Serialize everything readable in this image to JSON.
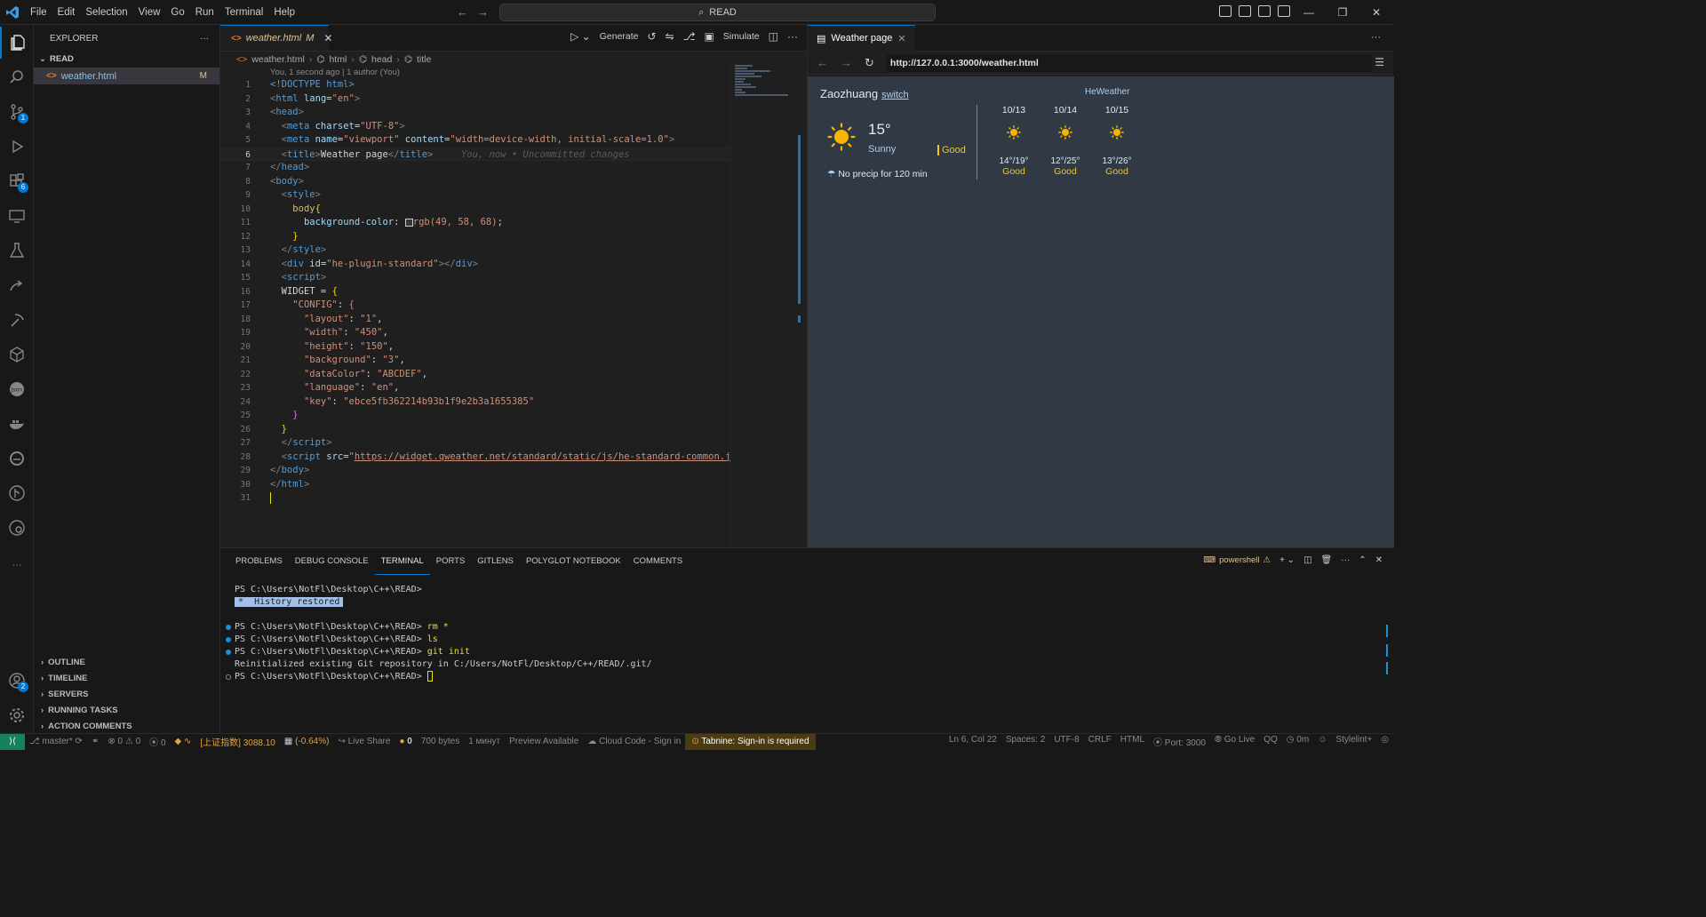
{
  "titlebar": {
    "menu": [
      "File",
      "Edit",
      "Selection",
      "View",
      "Go",
      "Run",
      "Terminal",
      "Help"
    ],
    "search": "READ"
  },
  "activity": {
    "badges": {
      "scm": "1",
      "extensions": "6",
      "accounts": "2"
    }
  },
  "sidebar": {
    "title": "EXPLORER",
    "folder": "READ",
    "file": {
      "name": "weather.html",
      "status": "M"
    },
    "sections": [
      "OUTLINE",
      "TIMELINE",
      "SERVERS",
      "RUNNING TASKS",
      "ACTION COMMENTS"
    ]
  },
  "editor": {
    "tab": {
      "name": "weather.html",
      "status": "M"
    },
    "toolbar": {
      "generate": "Generate",
      "simulate": "Simulate"
    },
    "breadcrumb": [
      "weather.html",
      "html",
      "head",
      "title"
    ],
    "blame": "You, 1 second ago | 1 author (You)",
    "current_line_hint": "You, now • Uncommitted changes",
    "line_numbers": [
      "1",
      "2",
      "3",
      "4",
      "5",
      "6",
      "7",
      "8",
      "9",
      "10",
      "11",
      "12",
      "13",
      "14",
      "15",
      "16",
      "17",
      "18",
      "19",
      "20",
      "21",
      "22",
      "23",
      "24",
      "25",
      "26",
      "27",
      "28",
      "29",
      "30",
      "31"
    ],
    "code": {
      "doctype": "<!DOCTYPE html>",
      "html_lang": "en",
      "charset": "UTF-8",
      "viewport_name": "viewport",
      "viewport_content": "width=device-width, initial-scale=1.0",
      "title": "Weather page",
      "bg_color": "rgb(49, 58, 68)",
      "div_id": "he-plugin-standard",
      "config": {
        "layout": "1",
        "width": "450",
        "height": "150",
        "background": "3",
        "dataColor": "ABCDEF",
        "language": "en",
        "key": "ebce5fb362214b93b1f9e2b3a1655385"
      },
      "script_src": "https://widget.qweather.net/standard/static/js/he-standard-common.js"
    }
  },
  "preview": {
    "tab_title": "Weather page",
    "url": "http://127.0.0.1:3000/weather.html",
    "widget": {
      "city": "Zaozhuang",
      "switch": "switch",
      "brand": "HeWeather",
      "temp": "15°",
      "condition": "Sunny",
      "aqi": "Good",
      "precip": "No precip for 120 min",
      "forecast": [
        {
          "date": "10/13",
          "range": "14°/19°",
          "quality": "Good"
        },
        {
          "date": "10/14",
          "range": "12°/25°",
          "quality": "Good"
        },
        {
          "date": "10/15",
          "range": "13°/26°",
          "quality": "Good"
        }
      ]
    }
  },
  "panel": {
    "tabs": [
      "PROBLEMS",
      "DEBUG CONSOLE",
      "TERMINAL",
      "PORTS",
      "GITLENS",
      "POLYGLOT NOTEBOOK",
      "COMMENTS"
    ],
    "active_tab": "TERMINAL",
    "shell": "powershell",
    "prompt": "PS C:\\Users\\NotFl\\Desktop\\C++\\READ>",
    "history_restored": "History restored",
    "history_mark": "*",
    "commands": [
      "rm *",
      "ls",
      "git init"
    ],
    "git_output": "Reinitialized existing Git repository in C:/Users/NotFl/Desktop/C++/READ/.git/"
  },
  "statusbar": {
    "branch": "master*",
    "errors": "0",
    "warnings": "0",
    "ports": "0",
    "stock_name": "[上证指数]",
    "stock_value": "3088.10",
    "stock_change": "(-0.64%)",
    "live_share": "Live Share",
    "deno": "0",
    "size": "700 bytes",
    "time_ago": "1 минут",
    "preview": "Preview Available",
    "cloud": "Cloud Code - Sign in",
    "tabnine": "Tabnine: Sign-in is required",
    "position": "Ln 6, Col 22",
    "spaces": "Spaces: 2",
    "encoding": "UTF-8",
    "eol": "CRLF",
    "language": "HTML",
    "port": "Port: 3000",
    "golive": "Go Live",
    "qq": "QQ",
    "timer": "0m",
    "stylelint": "Stylelint+"
  },
  "colors": {
    "accent": "#0078d4",
    "page_bg": "#313a44",
    "widget_text": "#abcdef",
    "aqi": "#f5c518"
  }
}
